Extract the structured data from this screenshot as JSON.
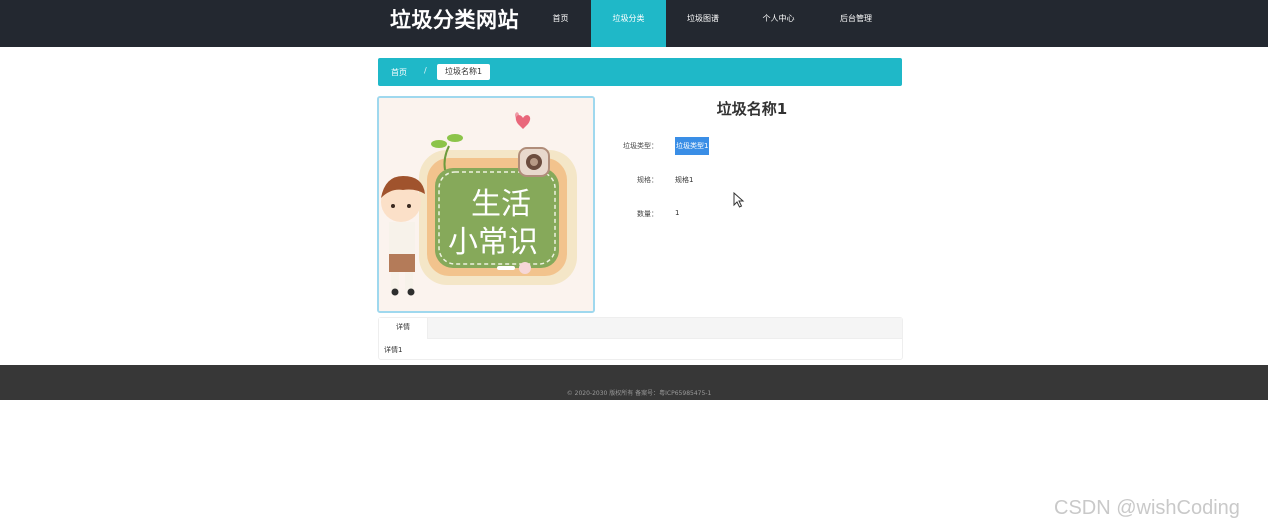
{
  "header": {
    "logo": "垃圾分类网站",
    "nav": [
      {
        "label": "首页",
        "active": false
      },
      {
        "label": "垃圾分类",
        "active": true
      },
      {
        "label": "垃圾图谱",
        "active": false
      },
      {
        "label": "个人中心",
        "active": false
      },
      {
        "label": "后台管理",
        "active": false
      }
    ]
  },
  "breadcrumb": {
    "home": "首页",
    "separator": "/",
    "current": "垃圾名称1"
  },
  "product": {
    "image_text_line1": "生活",
    "image_text_line2": "小常识",
    "title": "垃圾名称1",
    "fields": [
      {
        "label": "垃圾类型：",
        "value": "垃圾类型1",
        "selected": true
      },
      {
        "label": "规格：",
        "value": "规格1",
        "selected": false
      },
      {
        "label": "数量：",
        "value": "1",
        "selected": false
      }
    ]
  },
  "tabs": {
    "items": [
      "详情"
    ],
    "content": "详情1"
  },
  "footer": {
    "text": "© 2020-2030 版权所有 备案号：粤ICP65985475-1"
  },
  "watermark": "CSDN @wishCoding",
  "colors": {
    "header_bg": "#232830",
    "accent": "#1fb8c8",
    "footer_bg": "#373737"
  }
}
